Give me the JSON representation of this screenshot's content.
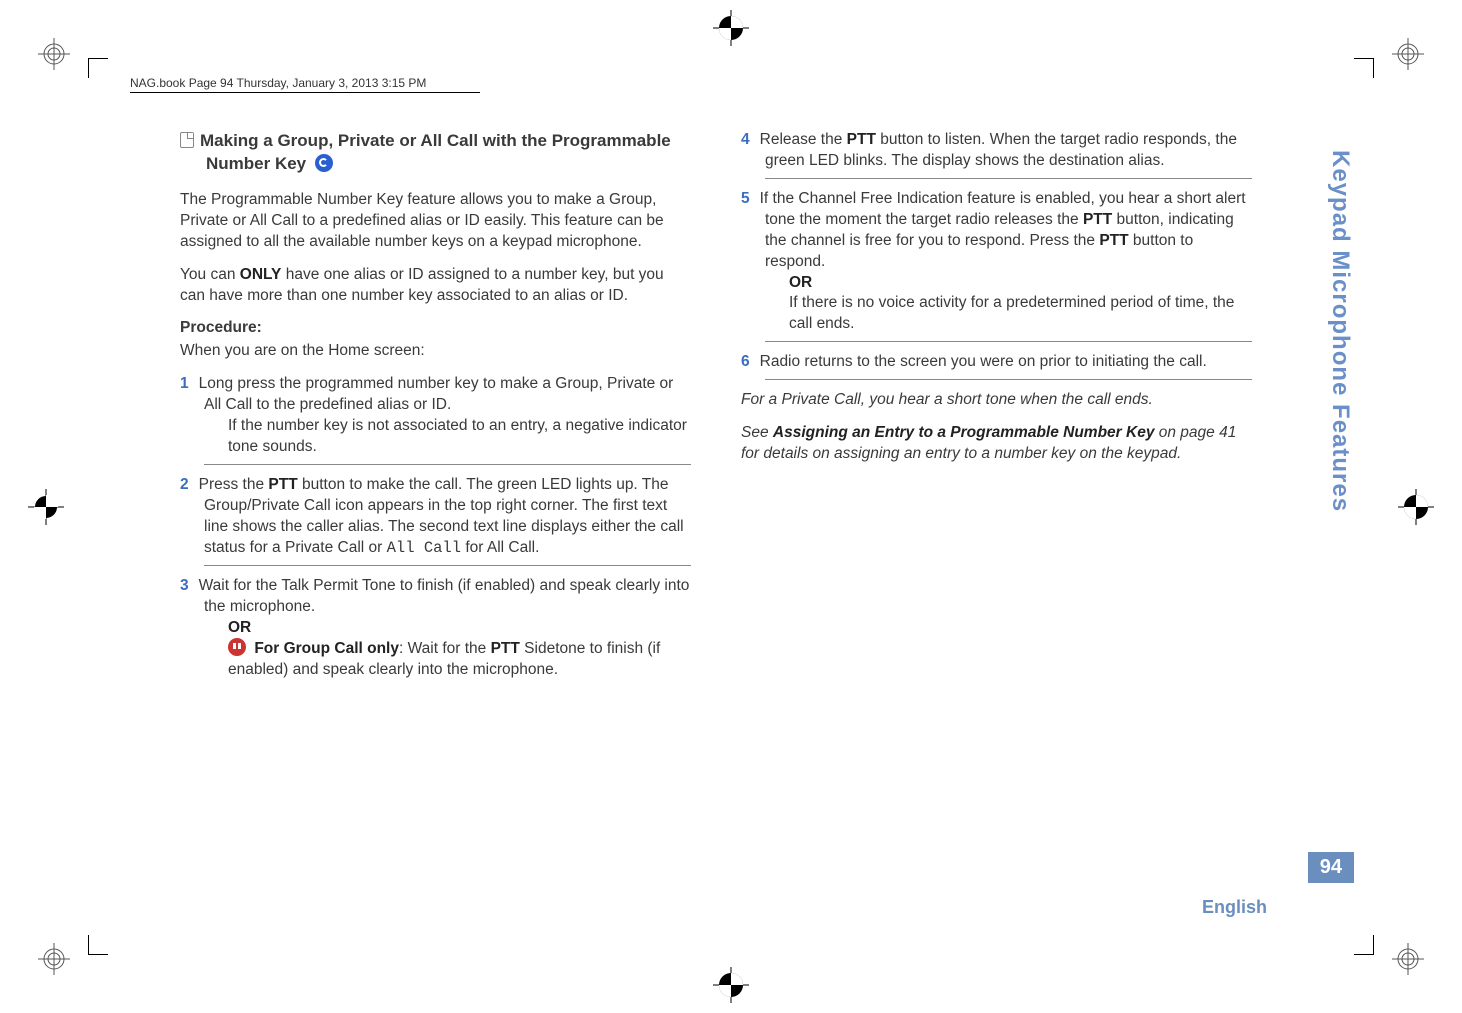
{
  "header": "NAG.book  Page 94  Thursday, January 3, 2013  3:15 PM",
  "left": {
    "title": "Making a Group, Private or All Call with the Programmable Number Key",
    "p1": "The Programmable Number Key feature allows you to make a Group, Private or All Call to a predefined alias or ID easily. This feature can be assigned to all the available number keys on a keypad microphone.",
    "p2a": "You can ",
    "p2b": "ONLY",
    "p2c": " have one alias or ID assigned to a number key, but you can have more than one number key associated to an alias or ID.",
    "proc": "Procedure:",
    "proc_sub": "When you are on the Home screen:",
    "s1": "Long press the programmed number key to make a Group, Private or All Call to the predefined alias or ID.",
    "s1b": "If the number key is not associated to an entry, a negative indicator tone sounds.",
    "s2a": "Press the ",
    "s2b": "PTT",
    "s2c": " button to make the call. The green LED lights up. The Group/Private Call icon appears in the top right corner. The first text line shows the caller alias. The second text line displays either the call status for a Private Call or ",
    "s2d": "All Call",
    "s2e": " for All Call.",
    "s3a": "Wait for the Talk Permit Tone to finish (if enabled) and speak clearly into the microphone.",
    "s3or": "OR",
    "s3b1": "For Group Call only",
    "s3b2": ": Wait for the ",
    "s3b3": "PTT",
    "s3b4": " Sidetone to finish (if enabled) and speak clearly into the microphone."
  },
  "right": {
    "s4a": "Release the ",
    "s4b": "PTT",
    "s4c": " button to listen. When the target radio responds, the green LED blinks. The display shows the destination alias.",
    "s5a": "If the Channel Free Indication feature is enabled, you hear a short alert tone the moment the target radio releases the ",
    "s5b": "PTT",
    "s5c": " button, indicating the channel is free for you to respond. Press the ",
    "s5d": "PTT",
    "s5e": " button to respond.",
    "s5or": "OR",
    "s5f": "If there is no voice activity for a predetermined period of time, the call ends.",
    "s6": "Radio returns to the screen you were on prior to initiating the call.",
    "foot1": "For a Private Call, you hear a short tone when the call ends.",
    "foot2a": "See ",
    "foot2b": "Assigning an Entry to a Programmable Number Key",
    "foot2c": " on page 41 for details on assigning an entry to a number key on the keypad."
  },
  "side_tab": "Keypad Microphone Features",
  "page_num": "94",
  "lang": "English"
}
